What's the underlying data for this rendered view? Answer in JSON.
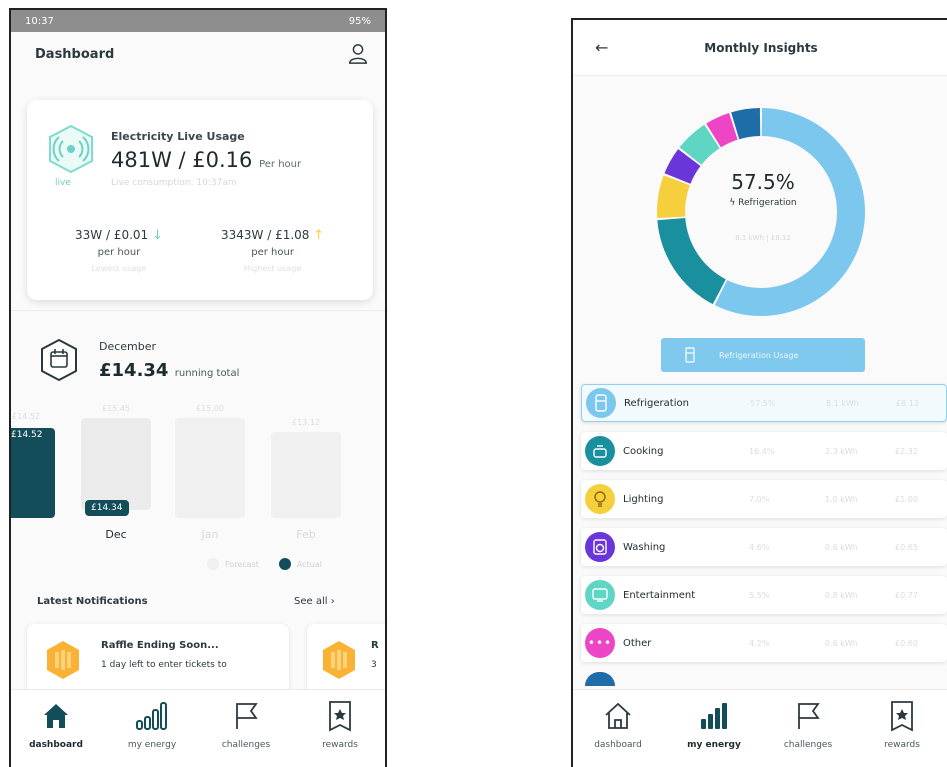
{
  "dashboard": {
    "status_bar": {
      "time": "10:37",
      "battery": "95%"
    },
    "title": "Dashboard",
    "live": {
      "title": "Electricity Live Usage",
      "value": "481W / £0.16",
      "unit": "Per hour",
      "status": "live",
      "sub": "Live consumption: 10:37am",
      "low": {
        "value": "33W / £0.01",
        "per": "per hour",
        "caption": "Lowest usage"
      },
      "high": {
        "value": "3343W / £1.08",
        "per": "per hour",
        "caption": "Highest usage"
      }
    },
    "month": {
      "name": "December",
      "total": "£14.34",
      "total_caption": "running total"
    },
    "bars": [
      {
        "month": "Nov",
        "top": "£14.52",
        "badge": "£14.52"
      },
      {
        "month": "Dec",
        "top": "£15.45",
        "badge": "£14.34"
      },
      {
        "month": "Jan",
        "top": "£15.00"
      },
      {
        "month": "Feb",
        "top": "£13.12"
      }
    ],
    "legend": {
      "actual": "Actual",
      "estimated": "Forecast"
    },
    "notifications": {
      "title": "Latest Notifications",
      "see_all": "See all",
      "items": [
        {
          "title": "Raffle Ending Soon...",
          "text": "1 day left to enter tickets to"
        },
        {
          "title": "R",
          "text": "3"
        }
      ]
    },
    "nav": [
      {
        "label": "dashboard",
        "icon": "home-icon"
      },
      {
        "label": "my energy",
        "icon": "bar-chart-icon"
      },
      {
        "label": "challenges",
        "icon": "flag-icon"
      },
      {
        "label": "rewards",
        "icon": "ticket-icon"
      }
    ]
  },
  "insights": {
    "title": "Monthly Insights",
    "donut": {
      "percent": "57.5%",
      "category": "Refrigeration",
      "sub": "8.1 kWh | £8.12"
    },
    "button": "Refrigeration Usage",
    "colors": {
      "refrigeration": "#7bc7ee",
      "cooking": "#1a8f9e",
      "lighting": "#f6cf3d",
      "washing": "#6a35d9",
      "entertainment": "#5fd6c4",
      "other": "#ee45c6",
      "misc": "#1e6ca8"
    },
    "categories": [
      {
        "name": "Refrigeration",
        "pct": "57.5%",
        "kwh": "8.1 kWh",
        "cost": "£8.12"
      },
      {
        "name": "Cooking",
        "pct": "16.4%",
        "kwh": "2.3 kWh",
        "cost": "£2.32"
      },
      {
        "name": "Lighting",
        "pct": "7.0%",
        "kwh": "1.0 kWh",
        "cost": "£1.00"
      },
      {
        "name": "Washing",
        "pct": "4.6%",
        "kwh": "0.6 kWh",
        "cost": "£0.65"
      },
      {
        "name": "Entertainment",
        "pct": "5.5%",
        "kwh": "0.8 kWh",
        "cost": "£0.77"
      },
      {
        "name": "Other",
        "pct": "4.2%",
        "kwh": "0.6 kWh",
        "cost": "£0.60"
      }
    ],
    "nav": [
      {
        "label": "dashboard",
        "icon": "home-outline-icon"
      },
      {
        "label": "my energy",
        "icon": "bar-chart-icon"
      },
      {
        "label": "challenges",
        "icon": "flag-icon"
      },
      {
        "label": "rewards",
        "icon": "ticket-icon"
      }
    ]
  }
}
